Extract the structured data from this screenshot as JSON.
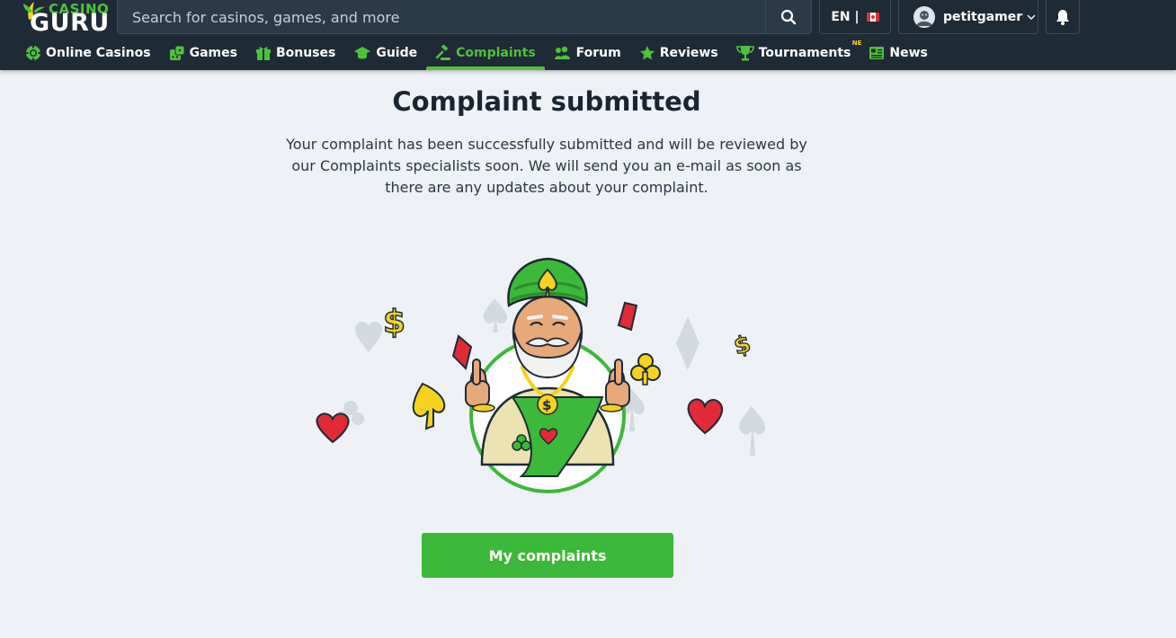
{
  "header": {
    "logo": {
      "casino_text": "CASINO",
      "guru_text": "GURU"
    },
    "search": {
      "placeholder": "Search for casinos, games, and more",
      "icon": "search-icon"
    },
    "language": {
      "code": "EN |",
      "flag_icon": "canada-flag-icon"
    },
    "user": {
      "name": "petitgamer",
      "avatar_icon": "avatar-icon",
      "chevron_icon": "chevron-down-icon"
    },
    "notifications": {
      "icon": "bell-icon"
    }
  },
  "nav": {
    "items": [
      {
        "label": "Online Casinos",
        "icon": "chip-icon"
      },
      {
        "label": "Games",
        "icon": "dice-icon"
      },
      {
        "label": "Bonuses",
        "icon": "gift-icon"
      },
      {
        "label": "Guide",
        "icon": "graduation-cap-icon"
      },
      {
        "label": "Complaints",
        "icon": "gavel-icon",
        "active": true
      },
      {
        "label": "Forum",
        "icon": "paw-icon"
      },
      {
        "label": "Reviews",
        "icon": "star-icon"
      },
      {
        "label": "Tournaments",
        "icon": "trophy-icon",
        "badge": "NE"
      },
      {
        "label": "News",
        "icon": "newspaper-icon"
      }
    ]
  },
  "main": {
    "title": "Complaint submitted",
    "message": "Your complaint has been successfully submitted and will be reviewed by our Complaints specialists soon. We will send you an e-mail as soon as there are any updates about your complaint.",
    "illustration": "guru-mascot-thumbs-up",
    "button_label": "My complaints"
  },
  "colors": {
    "header_bg": "#1e2a36",
    "accent_green": "#3cb83a",
    "page_bg": "#eef2f7",
    "badge_yellow": "#f4d21f"
  }
}
